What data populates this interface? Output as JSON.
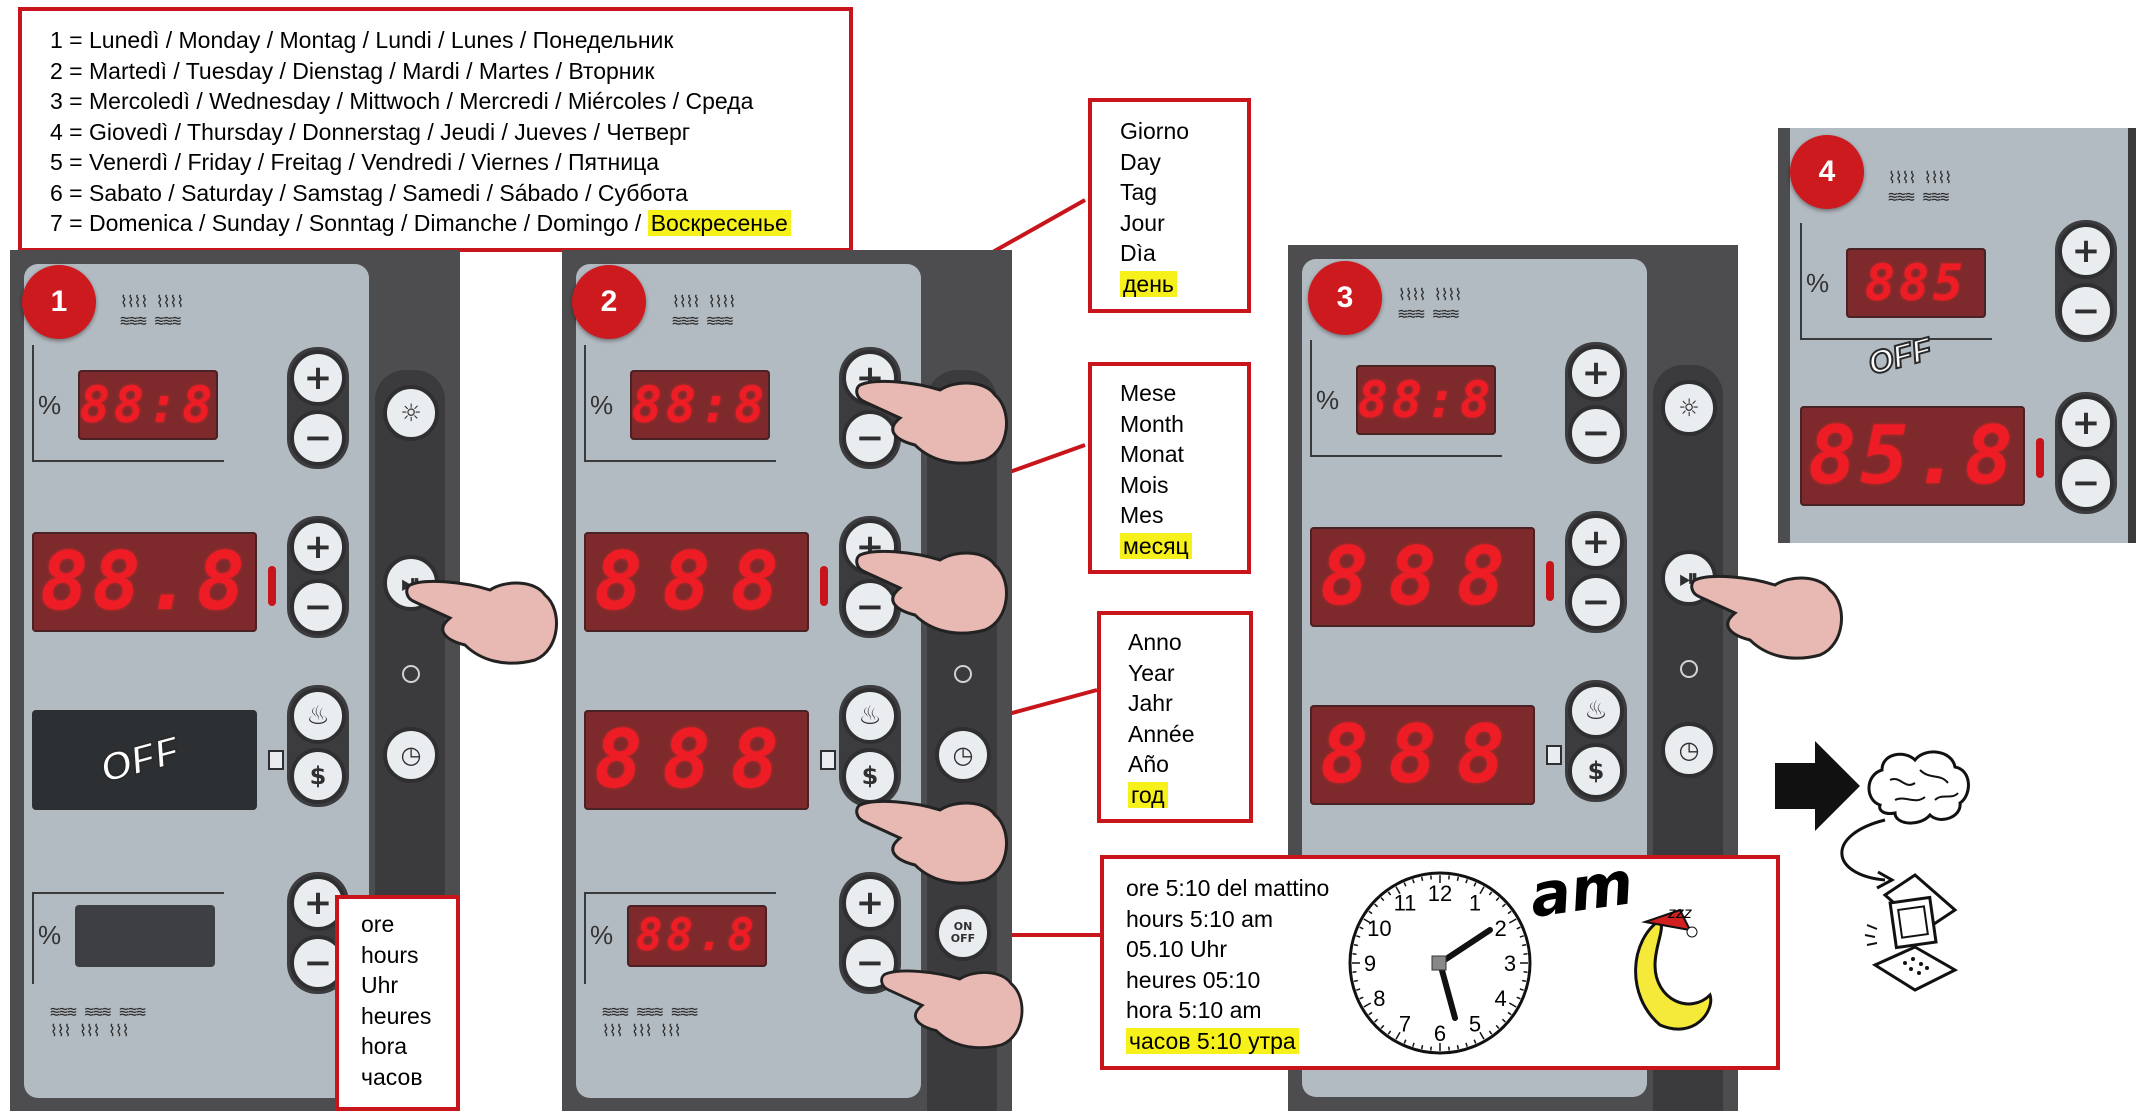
{
  "days_box": {
    "lines": [
      "1 = Lunedì / Monday / Montag / Lundi / Lunes / Понедельник",
      "2 = Martedì / Tuesday / Dienstag / Mardi / Martes / Вторник",
      "3 = Mercoledì / Wednesday / Mittwoch / Mercredi / Miércoles / Среда",
      "4 = Giovedì / Thursday / Donnerstag / Jeudi / Jueves / Четверг",
      "5 = Venerdì / Friday / Freitag / Vendredi / Viernes / Пятница",
      "6 = Sabato / Saturday / Samstag / Samedi / Sábado / Суббота",
      "7 = Domenica / Sunday / Sonntag / Dimanche / Domingo / "
    ],
    "highlight": "Воскресенье"
  },
  "day_box": {
    "lines": [
      "Giorno",
      "Day",
      "Tag",
      "Jour",
      "Dìa"
    ],
    "highlight": "день"
  },
  "month_box": {
    "lines": [
      "Mese",
      "Month",
      "Monat",
      "Mois",
      "Mes"
    ],
    "highlight": "месяц"
  },
  "year_box": {
    "lines": [
      "Anno",
      "Year",
      "Jahr",
      "Année",
      "Año"
    ],
    "highlight": "год"
  },
  "hours_box": {
    "lines": [
      "ore",
      "hours",
      "Uhr",
      "heures",
      "hora",
      "часов"
    ]
  },
  "time_box": {
    "lines": [
      "ore 5:10 del mattino",
      "hours 5:10 am",
      "05.10 Uhr",
      "heures 05:10",
      "hora 5:10 am"
    ],
    "highlight": "часов 5:10 утра",
    "am_label": "am",
    "zzz": "zzz",
    "clock_numbers": [
      "12",
      "1",
      "2",
      "3",
      "4",
      "5",
      "6",
      "7",
      "8",
      "9",
      "10",
      "11"
    ]
  },
  "steps": [
    "1",
    "2",
    "3",
    "4"
  ],
  "displays": {
    "p1_small": "88:8",
    "p1_main": "88.8",
    "p1_off": "OFF",
    "p2_small": "88:8",
    "p2_main": "888",
    "p2_mid": "888",
    "p2_bottom": "88.8",
    "p3_small": "88:8",
    "p3_main": "888",
    "p3_mid": "888",
    "p4_small": "885",
    "p4_main": "85.8",
    "p4_off": "OFF"
  },
  "symbols": {
    "percent": "%",
    "plus": "+",
    "minus": "−",
    "on": "ON",
    "off": "OFF"
  },
  "colors": {
    "accent_red": "#c8151b",
    "highlight_yellow": "#f6f01b",
    "display_red": "#ee1c25",
    "panel": "#b3bbc2",
    "frame": "#4d4d4f"
  }
}
